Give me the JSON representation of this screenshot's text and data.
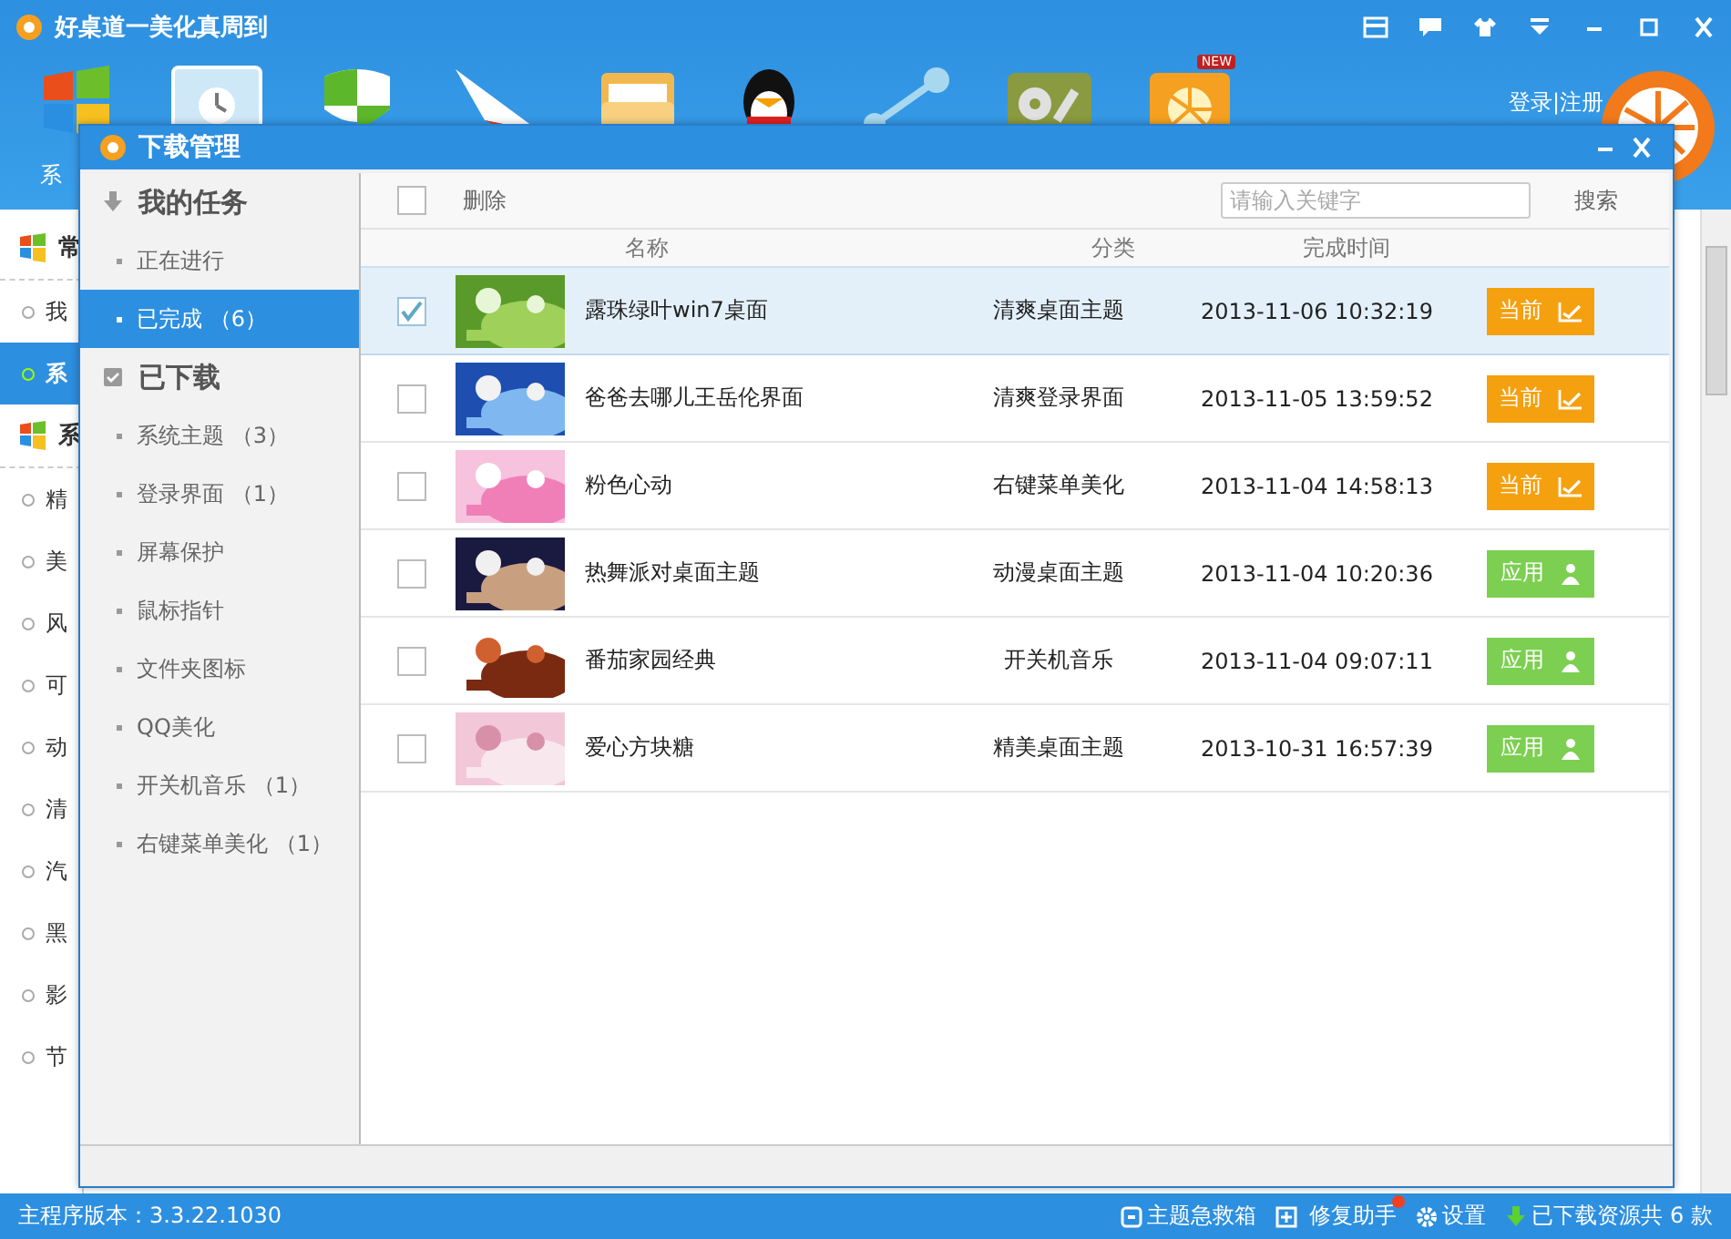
{
  "app": {
    "title": "好桌道一美化真周到",
    "toolbar_label": "系",
    "login": "登录|注册",
    "toolbar_icons": [
      {
        "kind": "windows"
      },
      {
        "kind": "clock"
      },
      {
        "kind": "shield"
      },
      {
        "kind": "plane"
      },
      {
        "kind": "folder"
      },
      {
        "kind": "penguin"
      },
      {
        "kind": "share"
      },
      {
        "kind": "tools"
      },
      {
        "kind": "orange",
        "badge": "NEW"
      }
    ],
    "sidebar": [
      {
        "kind": "heading",
        "label": "常"
      },
      {
        "kind": "item",
        "label": "我",
        "selected": false
      },
      {
        "kind": "item",
        "label": "系",
        "selected": true
      },
      {
        "kind": "heading",
        "label": "系"
      },
      {
        "kind": "item",
        "label": "精",
        "selected": false
      },
      {
        "kind": "item",
        "label": "美",
        "selected": false
      },
      {
        "kind": "item",
        "label": "风",
        "selected": false
      },
      {
        "kind": "item",
        "label": "可",
        "selected": false
      },
      {
        "kind": "item",
        "label": "动",
        "selected": false
      },
      {
        "kind": "item",
        "label": "清",
        "selected": false
      },
      {
        "kind": "item",
        "label": "汽",
        "selected": false
      },
      {
        "kind": "item",
        "label": "黑",
        "selected": false
      },
      {
        "kind": "item",
        "label": "影",
        "selected": false
      },
      {
        "kind": "item",
        "label": "节",
        "selected": false
      }
    ]
  },
  "dialog": {
    "title": "下载管理",
    "nav": [
      {
        "heading": "我的任务",
        "kind": "download",
        "items": [
          {
            "label": "正在进行",
            "selected": false
          },
          {
            "label": "已完成 （6）",
            "selected": true
          }
        ]
      },
      {
        "heading": "已下载",
        "kind": "check",
        "items": [
          {
            "label": "系统主题 （3）",
            "selected": false
          },
          {
            "label": "登录界面 （1）",
            "selected": false
          },
          {
            "label": "屏幕保护",
            "selected": false
          },
          {
            "label": "鼠标指针",
            "selected": false
          },
          {
            "label": "文件夹图标",
            "selected": false
          },
          {
            "label": "QQ美化",
            "selected": false
          },
          {
            "label": "开关机音乐 （1）",
            "selected": false
          },
          {
            "label": "右键菜单美化 （1）",
            "selected": false
          }
        ]
      }
    ],
    "toolbar": {
      "select_all_checked": false,
      "delete": "删除",
      "search_placeholder": "请输入关键字",
      "search": "搜索"
    },
    "columns": [
      "名称",
      "分类",
      "完成时间"
    ],
    "rows": [
      {
        "checked": true,
        "name": "露珠绿叶win7桌面",
        "category": "清爽桌面主题",
        "time": "2013-11-06 10:32:19",
        "action": {
          "label": "当前",
          "kind": "current"
        }
      },
      {
        "checked": false,
        "name": "爸爸去哪儿王岳伦界面",
        "category": "清爽登录界面",
        "time": "2013-11-05 13:59:52",
        "action": {
          "label": "当前",
          "kind": "current"
        }
      },
      {
        "checked": false,
        "name": "粉色心动",
        "category": "右键菜单美化",
        "time": "2013-11-04 14:58:13",
        "action": {
          "label": "当前",
          "kind": "current"
        }
      },
      {
        "checked": false,
        "name": "热舞派对桌面主题",
        "category": "动漫桌面主题",
        "time": "2013-11-04 10:20:36",
        "action": {
          "label": "应用",
          "kind": "apply"
        }
      },
      {
        "checked": false,
        "name": "番茄家园经典",
        "category": "开关机音乐",
        "time": "2013-11-04 09:07:11",
        "action": {
          "label": "应用",
          "kind": "apply"
        }
      },
      {
        "checked": false,
        "name": "爱心方块糖",
        "category": "精美桌面主题",
        "time": "2013-10-31 16:57:39",
        "action": {
          "label": "应用",
          "kind": "apply"
        }
      }
    ]
  },
  "status_bar": {
    "version": "主程序版本：3.3.22.1030",
    "items": [
      {
        "kind": "kit",
        "label": "主题急救箱"
      },
      {
        "kind": "repair",
        "label": "修复助手"
      },
      {
        "kind": "gear",
        "label": "设置"
      },
      {
        "kind": "download",
        "label": "已下载资源共 6 款"
      }
    ]
  }
}
